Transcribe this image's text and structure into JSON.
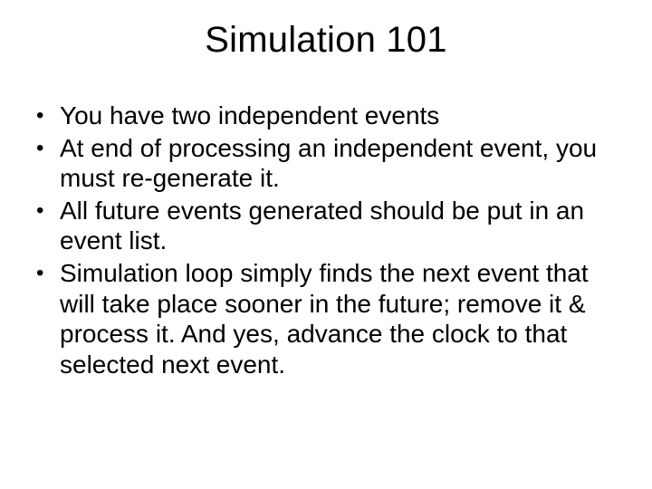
{
  "slide": {
    "title": "Simulation 101",
    "bullets": [
      "You have two independent events",
      "At end of processing an independent event, you must re-generate it.",
      "All future events generated should be put in an event list.",
      "Simulation loop simply finds the next event that will take place sooner in the future; remove it & process it. And yes, advance the clock to that selected next event."
    ]
  }
}
